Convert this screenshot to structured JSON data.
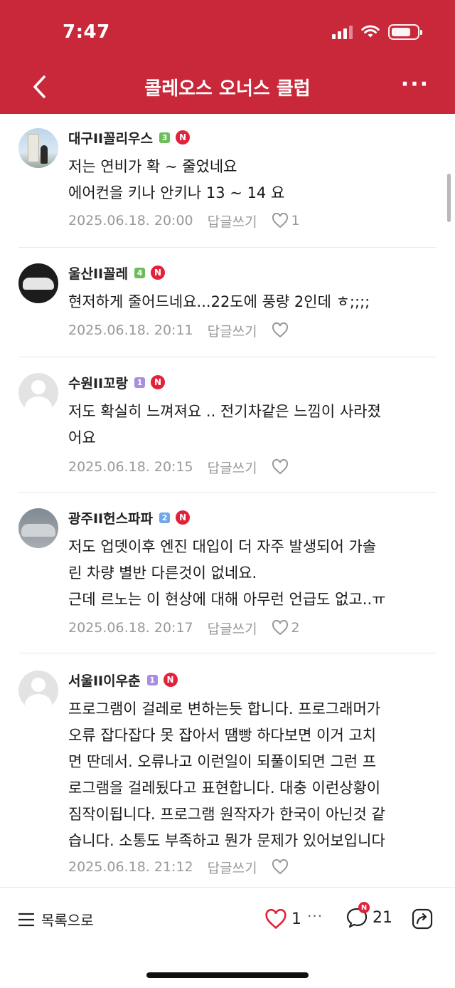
{
  "status_bar": {
    "time": "7:47"
  },
  "header": {
    "title": "콜레오스 오너스 클럽",
    "more_label": "···"
  },
  "colors": {
    "brand": "#c8283a",
    "n_badge": "#e0223a",
    "level_3": "#6cbe5c",
    "level_4": "#6cbe5c",
    "level_2": "#6fa8e8",
    "level_1": "#a98de0"
  },
  "comments": [
    {
      "nickname": "대구II꼴리우스",
      "level": "3",
      "new_badge": "N",
      "lines": [
        "저는 연비가 확 ~ 줄었네요",
        "에어컨을 키나 안키나 13 ~ 14 요"
      ],
      "date": "2025.06.18. 20:00",
      "reply_label": "답글쓰기",
      "likes": "1"
    },
    {
      "nickname": "울산II꼴레",
      "level": "4",
      "new_badge": "N",
      "lines": [
        "현저하게 줄어드네요...22도에 풍량 2인데 ㅎ;;;;"
      ],
      "date": "2025.06.18. 20:11",
      "reply_label": "답글쓰기",
      "likes": ""
    },
    {
      "nickname": "수원II꼬랑",
      "level": "1",
      "new_badge": "N",
      "lines": [
        "저도 확실히 느껴져요 .. 전기차같은 느낌이 사라졌",
        "어요"
      ],
      "date": "2025.06.18. 20:15",
      "reply_label": "답글쓰기",
      "likes": ""
    },
    {
      "nickname": "광주II헌스파파",
      "level": "2",
      "new_badge": "N",
      "lines": [
        "저도 업뎃이후 엔진 대입이 더 자주 발생되어 가솔",
        "린 차량 별반 다른것이 없네요.",
        "근데 르노는 이 현상에 대해 아무런 언급도 없고..ㅠ"
      ],
      "date": "2025.06.18. 20:17",
      "reply_label": "답글쓰기",
      "likes": "2"
    },
    {
      "nickname": "서울II이우춘",
      "level": "1",
      "new_badge": "N",
      "lines": [
        "프로그램이 걸레로 변하는듯 합니다. 프로그래머가",
        "오류 잡다잡다 못 잡아서 땜빵 하다보면 이거 고치",
        "면 딴데서. 오류나고 이런일이 되풀이되면 그런 프",
        "로그램을 걸레됬다고 표현합니다. 대충 이런상황이",
        "짐작이됩니다. 프로그램 원작자가 한국이 아닌것 같",
        "습니다. 소통도 부족하고 뭔가 문제가 있어보입니다"
      ],
      "date": "2025.06.18. 21:12",
      "reply_label": "답글쓰기",
      "likes": ""
    }
  ],
  "bottom_bar": {
    "list_label": "목록으로",
    "like_count": "1",
    "more_label": "···",
    "comment_badge": "N",
    "comment_count": "21"
  }
}
